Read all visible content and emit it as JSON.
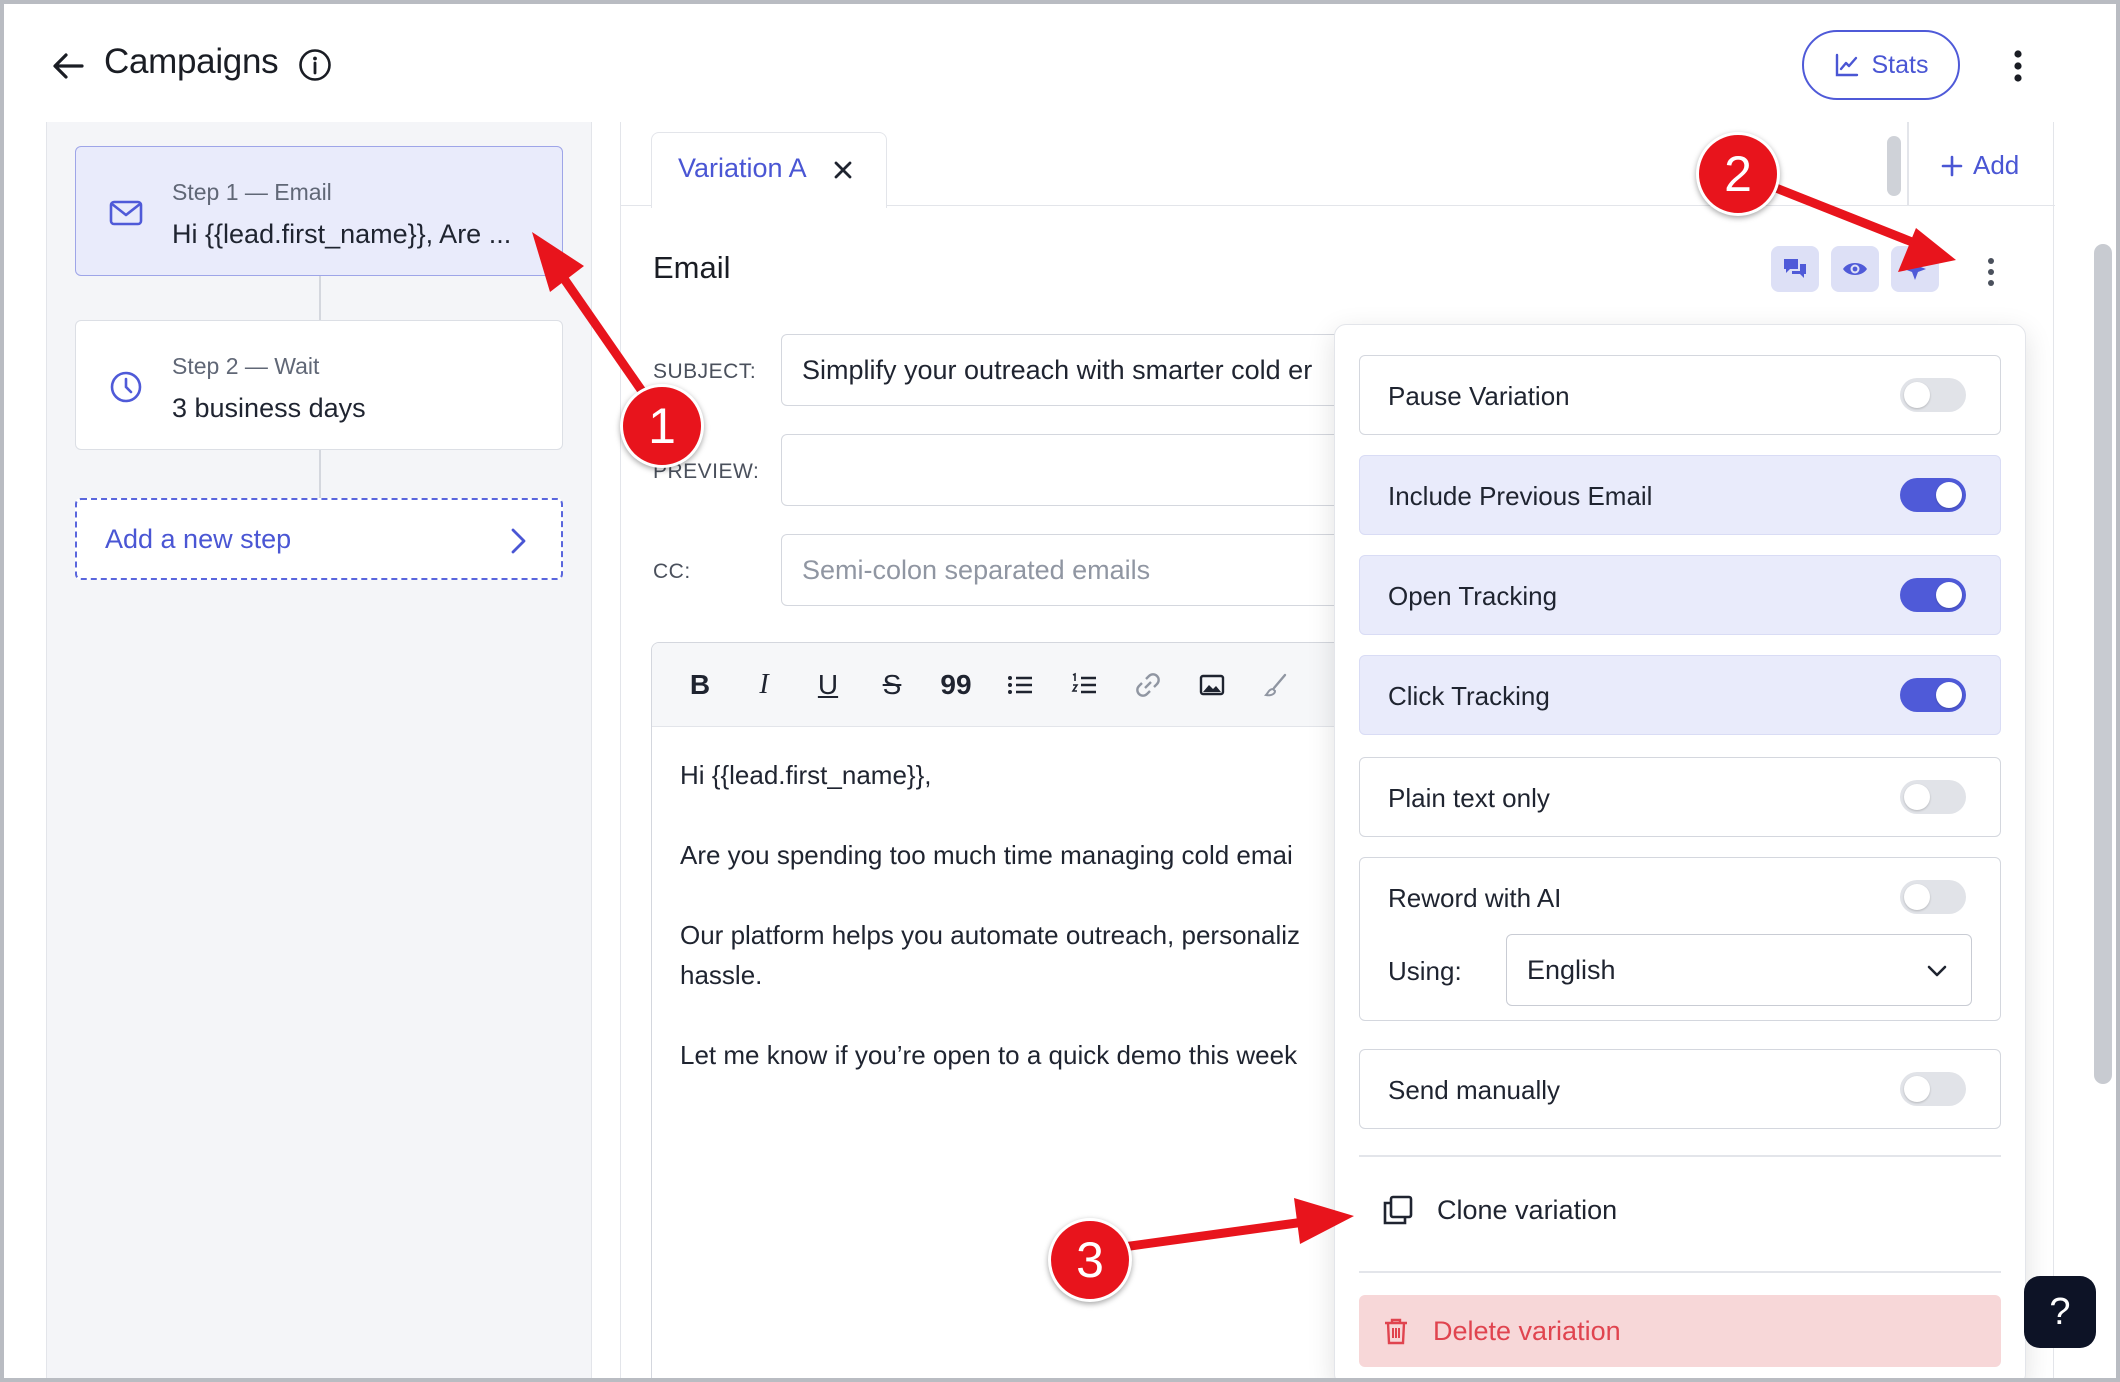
{
  "header": {
    "title": "Campaigns",
    "stats_label": "Stats"
  },
  "sequence": {
    "steps": [
      {
        "label": "Step 1 — Email",
        "text": "Hi {{lead.first_name}}, Are ..."
      },
      {
        "label": "Step 2 — Wait",
        "text": "3 business days"
      }
    ],
    "add_step_label": "Add a new step"
  },
  "tabs": {
    "active_label": "Variation A",
    "add_label": "Add"
  },
  "email": {
    "heading": "Email",
    "subject_label": "SUBJECT:",
    "subject_value": "Simplify your outreach with smarter cold er",
    "preview_label": "PREVIEW:",
    "preview_value": "",
    "cc_label": "CC:",
    "cc_placeholder": "Semi-colon separated emails",
    "body": [
      "Hi {{lead.first_name}},",
      "Are you spending too much time managing cold emai",
      "Our platform helps you automate outreach, personaliz",
      "hassle.",
      "Let me know if you’re open to a quick demo this week"
    ]
  },
  "toolbar": {
    "bold": "B",
    "italic": "I",
    "underline": "U",
    "strike": "S",
    "quote": "99"
  },
  "menu": {
    "options": [
      {
        "label": "Pause Variation",
        "on": false
      },
      {
        "label": "Include Previous Email",
        "on": true
      },
      {
        "label": "Open Tracking",
        "on": true
      },
      {
        "label": "Click Tracking",
        "on": true
      },
      {
        "label": "Plain text only",
        "on": false
      },
      {
        "label": "Reword with AI",
        "on": false
      },
      {
        "label": "Send manually",
        "on": false
      }
    ],
    "using_label": "Using:",
    "language": "English",
    "clone_label": "Clone variation",
    "delete_label": "Delete variation"
  },
  "help": {
    "label": "?"
  },
  "annotations": {
    "badge1": "1",
    "badge2": "2",
    "badge3": "3"
  },
  "colors": {
    "accent": "#4f5ad8",
    "annotation": "#e8141c",
    "danger": "#e0444f"
  }
}
